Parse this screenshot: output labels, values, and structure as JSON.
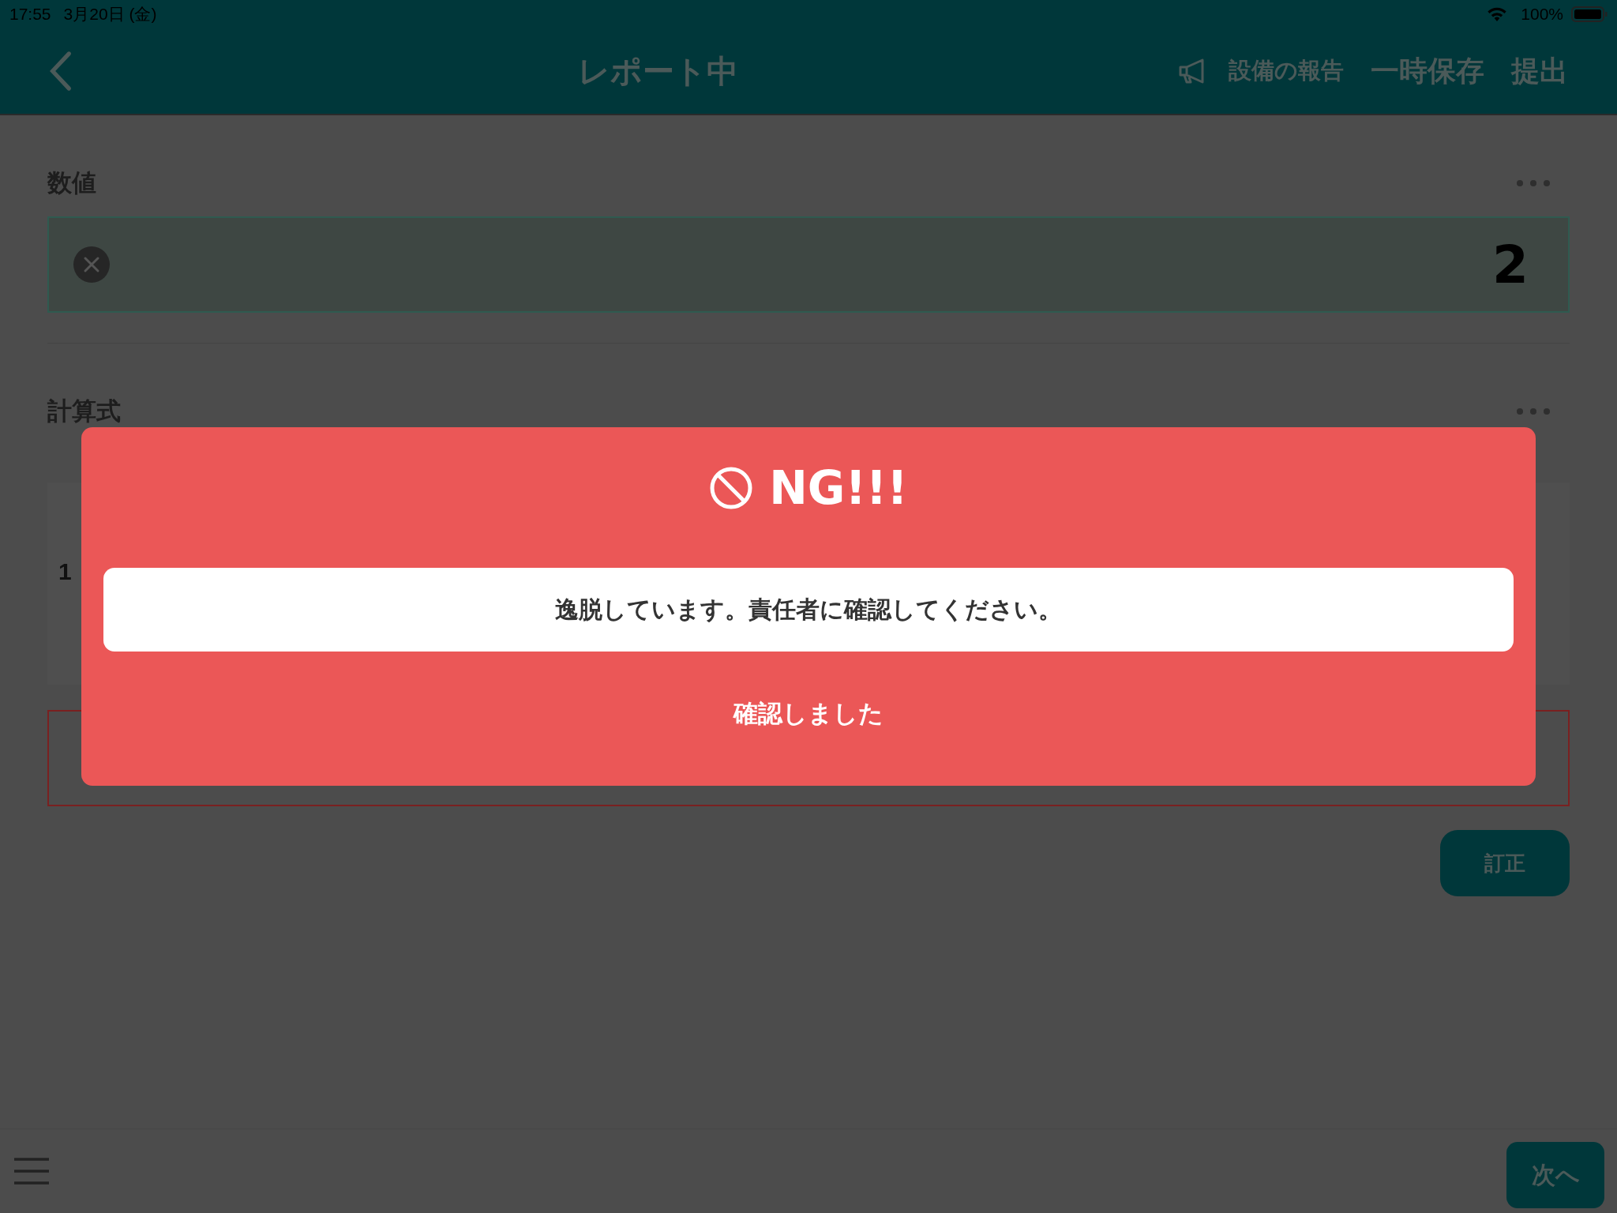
{
  "status_bar": {
    "time": "17:55",
    "date": "3月20日 (金)",
    "battery": "100%"
  },
  "header": {
    "title": "レポート中",
    "report_action": "設備の報告",
    "save_action": "一時保存",
    "submit_action": "提出"
  },
  "numeric_section": {
    "label": "数値",
    "value": "2"
  },
  "formula_section": {
    "label": "計算式",
    "card_value": "1"
  },
  "correct_button": "訂正",
  "next_button": "次へ",
  "dialog": {
    "title": "NG!!!",
    "message": "逸脱しています。責任者に確認してください。",
    "confirm_button": "確認しました"
  }
}
